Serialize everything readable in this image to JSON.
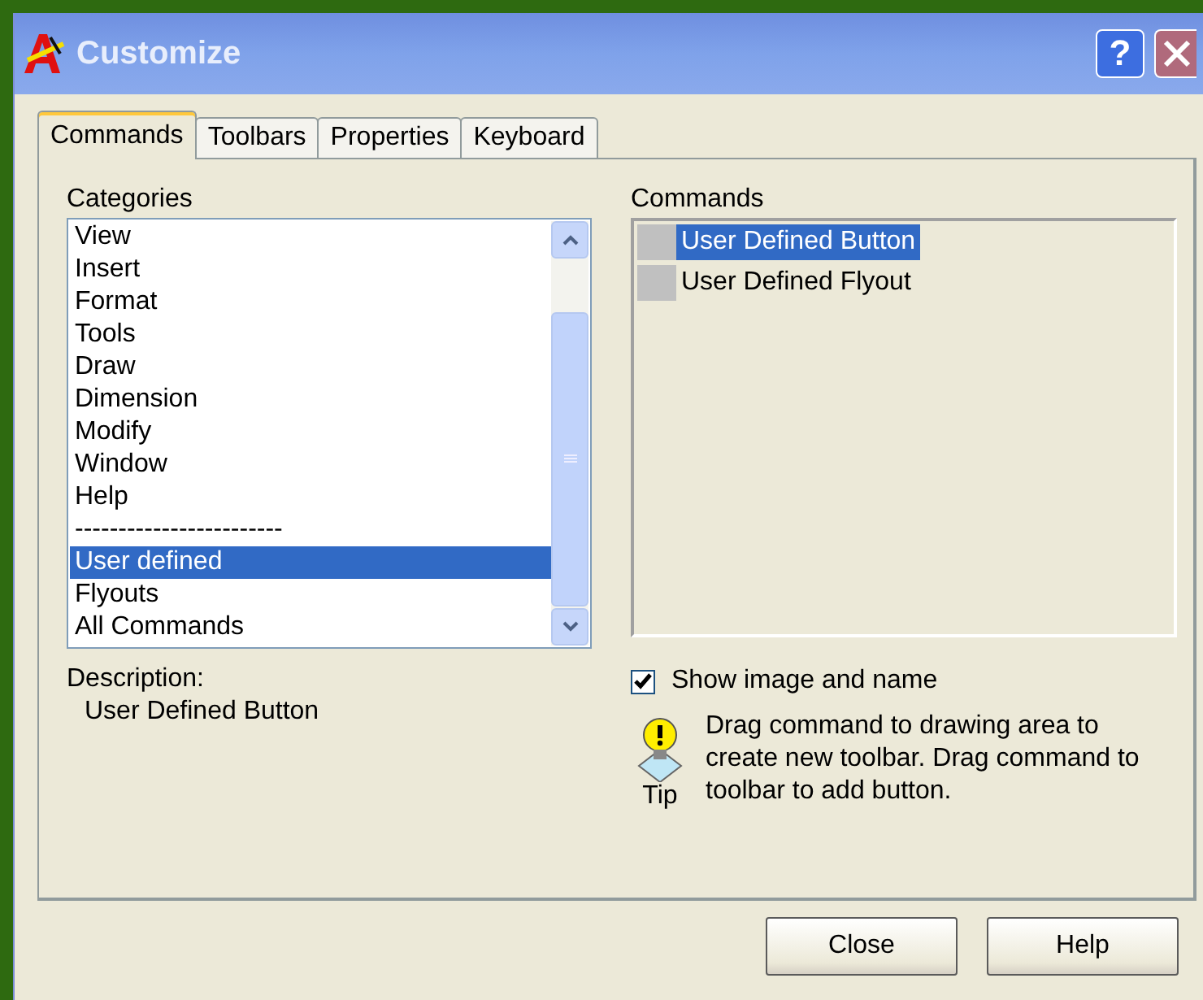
{
  "window": {
    "title": "Customize",
    "buttons": [
      "?"
    ]
  },
  "tabs": [
    {
      "label": "Commands",
      "selected": true
    },
    {
      "label": "Toolbars",
      "selected": false
    },
    {
      "label": "Properties",
      "selected": false
    },
    {
      "label": "Keyboard",
      "selected": false
    }
  ],
  "categories": {
    "label": "Categories",
    "items": [
      {
        "label": "View",
        "selected": false
      },
      {
        "label": "Insert",
        "selected": false
      },
      {
        "label": "Format",
        "selected": false
      },
      {
        "label": "Tools",
        "selected": false
      },
      {
        "label": "Draw",
        "selected": false
      },
      {
        "label": "Dimension",
        "selected": false
      },
      {
        "label": "Modify",
        "selected": false
      },
      {
        "label": "Window",
        "selected": false
      },
      {
        "label": "Help",
        "selected": false
      },
      {
        "label": "------------------------",
        "selected": false
      },
      {
        "label": "User defined",
        "selected": true
      },
      {
        "label": "Flyouts",
        "selected": false
      },
      {
        "label": "All Commands",
        "selected": false
      }
    ]
  },
  "commands": {
    "label": "Commands",
    "items": [
      {
        "label": "User Defined Button",
        "selected": true
      },
      {
        "label": "User Defined Flyout",
        "selected": false
      }
    ]
  },
  "description": {
    "label": "Description:",
    "value": "User Defined Button"
  },
  "show_image_and_name": {
    "label": "Show image and name",
    "checked": true
  },
  "tip": {
    "label": "Tip",
    "text": "Drag command to drawing area to create new toolbar. Drag command to toolbar to add button."
  },
  "buttons": [
    "Close",
    "Help"
  ]
}
